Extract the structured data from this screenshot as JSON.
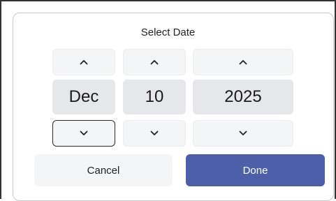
{
  "dialog": {
    "title": "Select Date",
    "month": "Dec",
    "day": "10",
    "year": "2025",
    "increment_icon": "chevron-up-icon",
    "decrement_icon": "chevron-down-icon",
    "cancel_label": "Cancel",
    "done_label": "Done",
    "colors": {
      "primary": "#4c5fa8",
      "value_background": "#e5e7ea",
      "button_background": "#f3f5f6"
    }
  }
}
